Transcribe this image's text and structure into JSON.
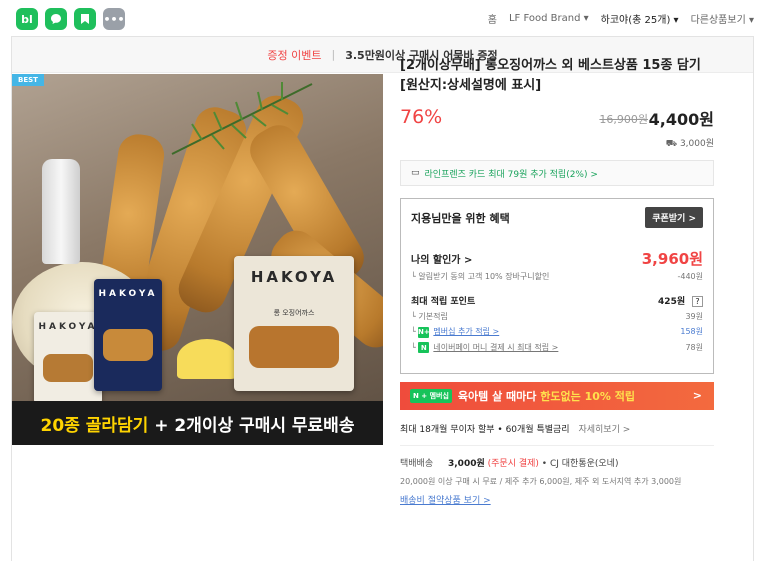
{
  "topbar": {
    "icons": [
      "naver-blog-icon",
      "chat-icon",
      "bookmark-icon",
      "more-icon"
    ],
    "breadcrumb": {
      "home": "홈",
      "brand": "LF Food Brand",
      "category": "하코야(총 25개)",
      "other": "다른상품보기"
    }
  },
  "event": {
    "label": "증정 이벤트",
    "text": "3.5만원이상 구매시 어묵바 증정"
  },
  "image": {
    "badge": "BEST",
    "brand_logo": "HAKOYA",
    "pkg_name": "롱 오징어까스",
    "banner_yellow": "20종 골라담기",
    "banner_white": " + 2개이상 구매시 무료배송"
  },
  "product": {
    "title": "[2개이상무배] 롱오징어까스 외 베스트상품 15종 담기 [원산지:상세설명에 표시]",
    "discount_rate": "76%",
    "original_price": "16,900원",
    "sale_price": "4,400원",
    "shipping": "3,000원"
  },
  "card_promo": "라인프렌즈 카드 최대 79원 추가 적립(2%) >",
  "benefit": {
    "title": "지용님만을 위한 혜택",
    "coupon_btn": "쿠폰받기 >",
    "my_price_label": "나의 할인가 >",
    "my_price": "3,960원",
    "alarm_label": "알림받기 동의 고객 10% 장바구니할인",
    "alarm_value": "-440원",
    "points_label": "최대 적립 포인트",
    "points_value": "425원",
    "help": "?",
    "basic_label": "기본적립",
    "basic_value": "39원",
    "membership_label": "멤버십 추가 적립 >",
    "membership_value": "158원",
    "npay_label": "네이버페이 머니 결제 시 최대 적립 >",
    "npay_value": "78원"
  },
  "npay_banner": {
    "tag": "N + 멤버십",
    "text1": "육아템 살 때마다 ",
    "text2": "한도없는 10% 적립",
    "arrow": ">"
  },
  "installment": {
    "text": "최대 18개월 무이자 할부 • 60개월 특별금리",
    "link": "자세히보기 >"
  },
  "delivery": {
    "label": "택배배송",
    "price": "3,000원",
    "pay": "(주문시 결제)",
    "carrier": "• CJ 대한통운(오네)",
    "desc": "20,000원 이상 구매 시 무료 / 제주 추가 6,000원, 제주 외 도서지역 추가 3,000원",
    "link": "배송비 절약상품 보기 >"
  }
}
